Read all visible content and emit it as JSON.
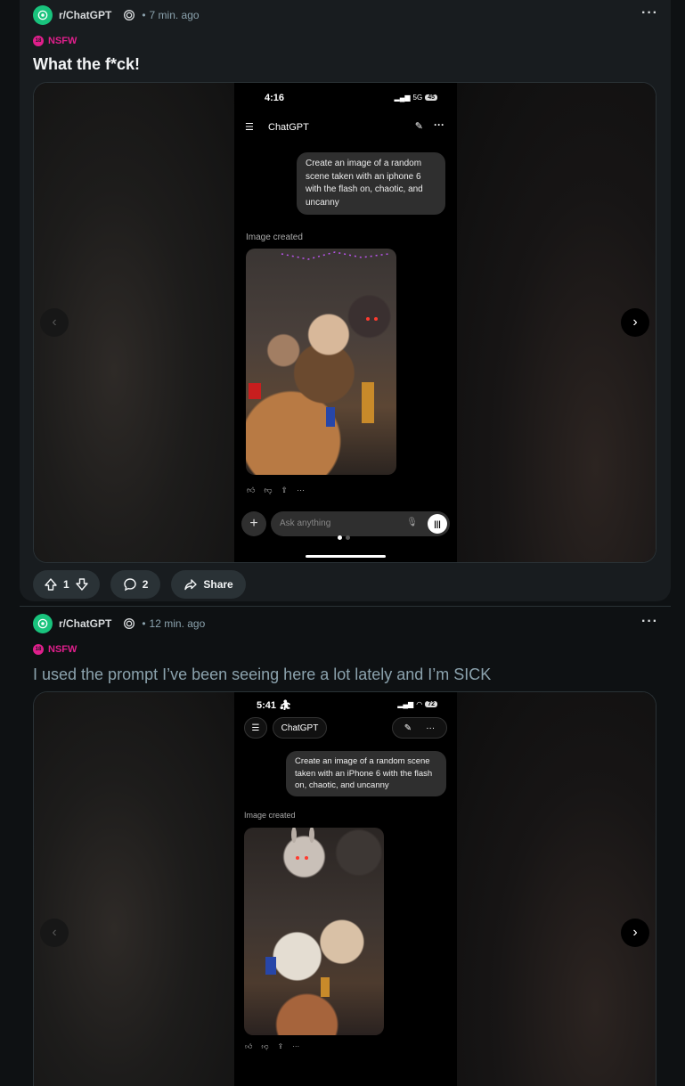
{
  "posts": [
    {
      "subreddit": "r/ChatGPT",
      "time": "7 min. ago",
      "nsfw_label": "NSFW",
      "title": "What the f*ck!",
      "phone": {
        "time": "4:16",
        "network": "5G",
        "battery": "45",
        "app_title": "ChatGPT",
        "prompt": "Create an image of a random scene taken with an iphone 6 with the flash on, chaotic, and uncanny",
        "image_created": "Image created",
        "input_placeholder": "Ask anything"
      },
      "votes": "1",
      "comments": "2",
      "share_label": "Share"
    },
    {
      "subreddit": "r/ChatGPT",
      "time": "12 min. ago",
      "nsfw_label": "NSFW",
      "title": "I used the prompt I’ve been seeing here a lot lately and I’m SICK",
      "phone": {
        "time": "5:41",
        "battery": "72",
        "app_title": "ChatGPT",
        "prompt": "Create an image of a random scene taken with an iPhone 6 with the flash on, chaotic, and uncanny",
        "image_created": "Image created"
      }
    }
  ],
  "icons": {
    "more": "more-options-icon",
    "upvote": "upvote-arrow-icon",
    "downvote": "downvote-arrow-icon",
    "comment": "comment-bubble-icon",
    "share": "share-arrow-icon",
    "chevron_left": "chevron-left-icon",
    "chevron_right": "chevron-right-icon"
  },
  "colors": {
    "background": "#0e1113",
    "card": "#181c1f",
    "nsfw": "#e01f8c",
    "subreddit_icon": "#19c37d",
    "pill": "#2a3236",
    "muted_text": "#8ba2ad"
  }
}
